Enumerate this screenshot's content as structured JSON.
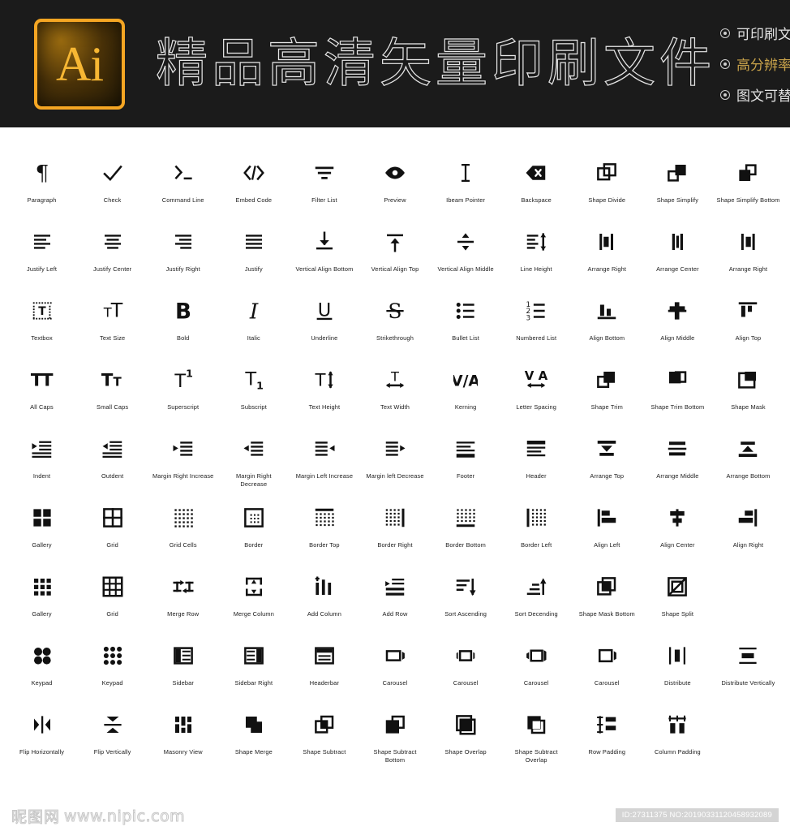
{
  "banner": {
    "logo_text": "Ai",
    "title": "精品高清矢量印刷文件",
    "features": [
      {
        "label": "可印刷文件",
        "accent": false
      },
      {
        "label": "高分辨率",
        "accent": true
      },
      {
        "label": "图文可替换文件",
        "accent": false
      }
    ],
    "colors": {
      "background": "#1b1b1b",
      "logo_border": "#f5a623",
      "logo_text": "#f7b733",
      "accent_text": "#c8a24a"
    }
  },
  "grid": {
    "rows": [
      [
        {
          "icon": "paragraph-icon",
          "label": "Paragraph"
        },
        {
          "icon": "check-icon",
          "label": "Check"
        },
        {
          "icon": "command-line-icon",
          "label": "Command Line"
        },
        {
          "icon": "embed-code-icon",
          "label": "Embed Code"
        },
        {
          "icon": "filter-list-icon",
          "label": "Filter List"
        },
        {
          "icon": "preview-icon",
          "label": "Preview"
        },
        {
          "icon": "ibeam-pointer-icon",
          "label": "Ibeam Pointer"
        },
        {
          "icon": "backspace-icon",
          "label": "Backspace"
        },
        {
          "icon": "shape-divide-icon",
          "label": "Shape Divide"
        },
        {
          "icon": "shape-simplify-icon",
          "label": "Shape Simplify"
        },
        {
          "icon": "shape-simplify-bottom-icon",
          "label": "Shape Simplify Bottom"
        }
      ],
      [
        {
          "icon": "justify-left-icon",
          "label": "Justify Left"
        },
        {
          "icon": "justify-center-icon",
          "label": "Justify Center"
        },
        {
          "icon": "justify-right-icon",
          "label": "Justify Right"
        },
        {
          "icon": "justify-icon",
          "label": "Justify"
        },
        {
          "icon": "vertical-align-bottom-icon",
          "label": "Vertical Align Bottom"
        },
        {
          "icon": "vertical-align-top-icon",
          "label": "Vertical Align Top"
        },
        {
          "icon": "vertical-align-middle-icon",
          "label": "Vertical Align Middle"
        },
        {
          "icon": "line-height-icon",
          "label": "Line Height"
        },
        {
          "icon": "arrange-right-icon",
          "label": "Arrange Right"
        },
        {
          "icon": "arrange-center-icon",
          "label": "Arrange Center"
        },
        {
          "icon": "arrange-right-alt-icon",
          "label": "Arrange Right"
        }
      ],
      [
        {
          "icon": "textbox-icon",
          "label": "Textbox"
        },
        {
          "icon": "text-size-icon",
          "label": "Text Size"
        },
        {
          "icon": "bold-icon",
          "label": "Bold"
        },
        {
          "icon": "italic-icon",
          "label": "Italic"
        },
        {
          "icon": "underline-icon",
          "label": "Underline"
        },
        {
          "icon": "strikethrough-icon",
          "label": "Strikethrough"
        },
        {
          "icon": "bullet-list-icon",
          "label": "Bullet List"
        },
        {
          "icon": "numbered-list-icon",
          "label": "Numbered List"
        },
        {
          "icon": "align-bottom-icon",
          "label": "Align Bottom"
        },
        {
          "icon": "align-middle-icon",
          "label": "Align Middle"
        },
        {
          "icon": "align-top-icon",
          "label": "Align Top"
        }
      ],
      [
        {
          "icon": "all-caps-icon",
          "label": "All Caps"
        },
        {
          "icon": "small-caps-icon",
          "label": "Small Caps"
        },
        {
          "icon": "superscript-icon",
          "label": "Superscript"
        },
        {
          "icon": "subscript-icon",
          "label": "Subscript"
        },
        {
          "icon": "text-height-icon",
          "label": "Text Height"
        },
        {
          "icon": "text-width-icon",
          "label": "Text Width"
        },
        {
          "icon": "kerning-icon",
          "label": "Kerning"
        },
        {
          "icon": "letter-spacing-icon",
          "label": "Letter Spacing"
        },
        {
          "icon": "shape-trim-icon",
          "label": "Shape Trim"
        },
        {
          "icon": "shape-trim-bottom-icon",
          "label": "Shape Trim Bottom"
        },
        {
          "icon": "shape-mask-icon",
          "label": "Shape Mask"
        }
      ],
      [
        {
          "icon": "indent-icon",
          "label": "Indent"
        },
        {
          "icon": "outdent-icon",
          "label": "Outdent"
        },
        {
          "icon": "margin-right-increase-icon",
          "label": "Margin Right Increase"
        },
        {
          "icon": "margin-right-decrease-icon",
          "label": "Margin Right Decrease"
        },
        {
          "icon": "margin-left-increase-icon",
          "label": "Margin Left Increase"
        },
        {
          "icon": "margin-left-decrease-icon",
          "label": "Margin left Decrease"
        },
        {
          "icon": "footer-icon",
          "label": "Footer"
        },
        {
          "icon": "header-icon",
          "label": "Header"
        },
        {
          "icon": "arrange-top-icon",
          "label": "Arrange Top"
        },
        {
          "icon": "arrange-middle-icon",
          "label": "Arrange Middle"
        },
        {
          "icon": "arrange-bottom-icon",
          "label": "Arrange Bottom"
        }
      ],
      [
        {
          "icon": "gallery-icon",
          "label": "Gallery"
        },
        {
          "icon": "grid-icon",
          "label": "Grid"
        },
        {
          "icon": "grid-cells-icon",
          "label": "Grid Cells"
        },
        {
          "icon": "border-icon",
          "label": "Border"
        },
        {
          "icon": "border-top-icon",
          "label": "Border Top"
        },
        {
          "icon": "border-right-icon",
          "label": "Border Right"
        },
        {
          "icon": "border-bottom-icon",
          "label": "Border Bottom"
        },
        {
          "icon": "border-left-icon",
          "label": "Border Left"
        },
        {
          "icon": "align-left-icon",
          "label": "Align Left"
        },
        {
          "icon": "align-center-icon",
          "label": "Align Center"
        },
        {
          "icon": "align-right-icon",
          "label": "Align Right"
        }
      ],
      [
        {
          "icon": "gallery-dots-icon",
          "label": "Gallery"
        },
        {
          "icon": "grid-table-icon",
          "label": "Grid"
        },
        {
          "icon": "merge-row-icon",
          "label": "Merge Row"
        },
        {
          "icon": "merge-column-icon",
          "label": "Merge Column"
        },
        {
          "icon": "add-column-icon",
          "label": "Add Column"
        },
        {
          "icon": "add-row-icon",
          "label": "Add Row"
        },
        {
          "icon": "sort-ascending-icon",
          "label": "Sort Ascending"
        },
        {
          "icon": "sort-descending-icon",
          "label": "Sort Decending"
        },
        {
          "icon": "shape-mask-bottom-icon",
          "label": "Shape Mask Bottom"
        },
        {
          "icon": "shape-split-icon",
          "label": "Shape Split"
        },
        {
          "icon": "",
          "label": ""
        }
      ],
      [
        {
          "icon": "keypad-four-icon",
          "label": "Keypad"
        },
        {
          "icon": "keypad-nine-icon",
          "label": "Keypad"
        },
        {
          "icon": "sidebar-icon",
          "label": "Sidebar"
        },
        {
          "icon": "sidebar-right-icon",
          "label": "Sidebar Right"
        },
        {
          "icon": "headerbar-icon",
          "label": "Headerbar"
        },
        {
          "icon": "carousel-right-icon",
          "label": "Carousel"
        },
        {
          "icon": "carousel-left-icon",
          "label": "Carousel"
        },
        {
          "icon": "carousel-both-icon",
          "label": "Carousel"
        },
        {
          "icon": "carousel-wide-icon",
          "label": "Carousel"
        },
        {
          "icon": "distribute-icon",
          "label": "Distribute"
        },
        {
          "icon": "distribute-vertically-icon",
          "label": "Distribute Vertically"
        }
      ],
      [
        {
          "icon": "flip-horizontally-icon",
          "label": "Flip Horizontally"
        },
        {
          "icon": "flip-vertically-icon",
          "label": "Flip Vertically"
        },
        {
          "icon": "masonry-view-icon",
          "label": "Masonry View"
        },
        {
          "icon": "shape-merge-icon",
          "label": "Shape Merge"
        },
        {
          "icon": "shape-subtract-icon",
          "label": "Shape Subtract"
        },
        {
          "icon": "shape-subtract-bottom-icon",
          "label": "Shape Subtract Bottom"
        },
        {
          "icon": "shape-overlap-icon",
          "label": "Shape Overlap"
        },
        {
          "icon": "shape-subtract-overlap-icon",
          "label": "Shape Subtract Overlap"
        },
        {
          "icon": "row-padding-icon",
          "label": "Row Padding"
        },
        {
          "icon": "column-padding-icon",
          "label": "Column Padding"
        },
        {
          "icon": "",
          "label": ""
        }
      ]
    ]
  },
  "footer": {
    "watermark_cjk": "昵图网",
    "watermark_url": "www.nipic.com",
    "id_badge": "ID:27311375 NO:20190331120458932089"
  }
}
